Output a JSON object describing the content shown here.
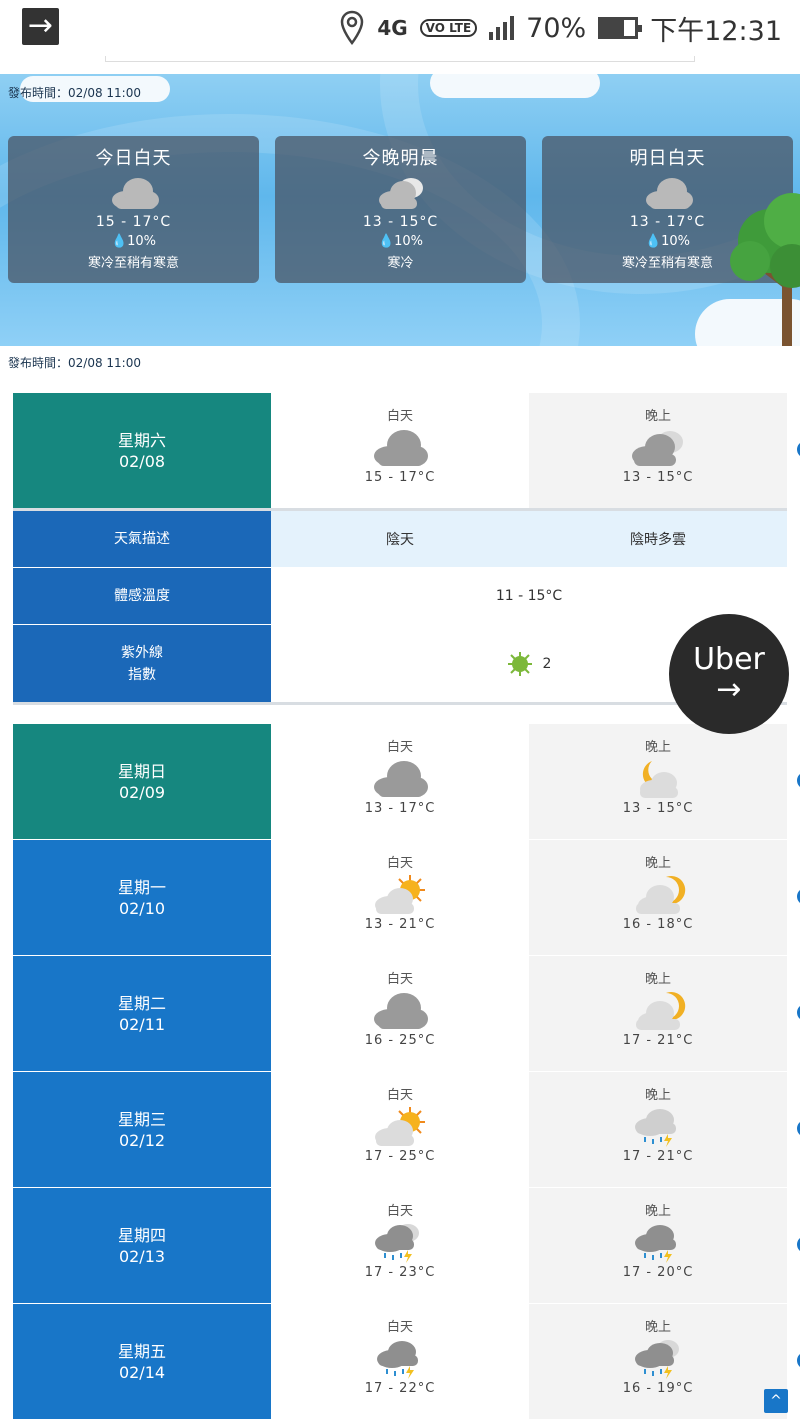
{
  "status_bar": {
    "network": "4G",
    "volte": "VO LTE",
    "battery": "70%",
    "time": "下午12:31"
  },
  "banner": {
    "publish_time": "發布時間：02/08 11:00",
    "cards": [
      {
        "title": "今日白天",
        "icon": "cloudy-icon",
        "temp": "15 - 17°C",
        "rain": "10%",
        "desc": "寒冷至稍有寒意"
      },
      {
        "title": "今晚明晨",
        "icon": "cloudy-night-icon",
        "temp": "13 - 15°C",
        "rain": "10%",
        "desc": "寒冷"
      },
      {
        "title": "明日白天",
        "icon": "cloudy-icon",
        "temp": "13 - 17°C",
        "rain": "10%",
        "desc": "寒冷至稍有寒意"
      }
    ]
  },
  "weekly": {
    "publish_time": "發布時間：02/08 11:00",
    "day_label": "白天",
    "night_label": "晚上",
    "days": [
      {
        "weekday": "星期六",
        "date": "02/08",
        "day_icon": "cloudy-icon",
        "day_temp": "15 - 17°C",
        "night_icon": "cloudy-icon",
        "night_temp": "13 - 15°C",
        "expanded": true,
        "toggle": "−"
      },
      {
        "weekday": "星期日",
        "date": "02/09",
        "day_icon": "cloudy-icon",
        "day_temp": "13 - 17°C",
        "night_icon": "moon-cloud-icon",
        "night_temp": "13 - 15°C",
        "toggle": "+"
      },
      {
        "weekday": "星期一",
        "date": "02/10",
        "day_icon": "sun-cloud-icon",
        "day_temp": "13 - 21°C",
        "night_icon": "moon-cloud-icon",
        "night_temp": "16 - 18°C",
        "toggle": "+"
      },
      {
        "weekday": "星期二",
        "date": "02/11",
        "day_icon": "cloudy-icon",
        "day_temp": "16 - 25°C",
        "night_icon": "moon-cloud-icon",
        "night_temp": "17 - 21°C",
        "toggle": "+"
      },
      {
        "weekday": "星期三",
        "date": "02/12",
        "day_icon": "sun-cloud-icon",
        "day_temp": "17 - 25°C",
        "night_icon": "rain-thunder-icon",
        "night_temp": "17 - 21°C",
        "toggle": "+"
      },
      {
        "weekday": "星期四",
        "date": "02/13",
        "day_icon": "rain-thunder-icon",
        "day_temp": "17 - 23°C",
        "night_icon": "rain-thunder-icon",
        "night_temp": "17 - 20°C",
        "toggle": "+"
      },
      {
        "weekday": "星期五",
        "date": "02/14",
        "day_icon": "rain-thunder-icon",
        "day_temp": "17 - 22°C",
        "night_icon": "rain-thunder-icon",
        "night_temp": "16 - 19°C",
        "toggle": "+"
      }
    ],
    "details": {
      "desc_label": "天氣描述",
      "desc_day": "陰天",
      "desc_night": "陰時多雲",
      "feel_label": "體感溫度",
      "feel_value": "11 - 15°C",
      "uv_label_1": "紫外線",
      "uv_label_2": "指數",
      "uv_value": "2"
    }
  },
  "uber": {
    "label": "Uber",
    "arrow": "→"
  },
  "back_to_top": "^",
  "colors": {
    "teal": "#16877f",
    "blue": "#1876c8",
    "detail_blue": "#1b68b8",
    "desc_bg": "#e4f2fc"
  }
}
